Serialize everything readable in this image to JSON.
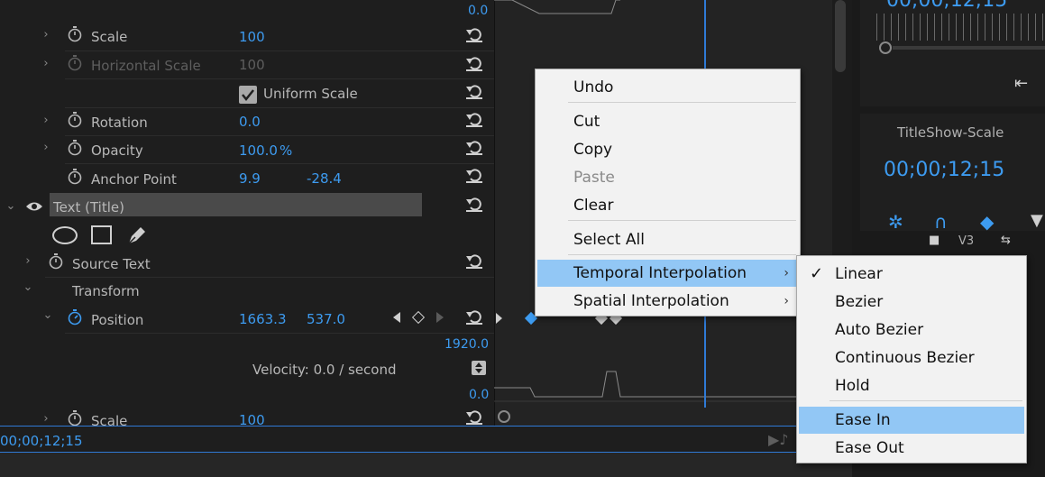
{
  "effect_controls": {
    "top_value": "0.0",
    "rows": [
      {
        "id": "scale",
        "name": "Scale",
        "value": "100"
      },
      {
        "id": "hscale",
        "name": "Horizontal Scale",
        "value": "100"
      },
      {
        "id": "uniform",
        "name": "Uniform Scale"
      },
      {
        "id": "rotation",
        "name": "Rotation",
        "value": "0.0"
      },
      {
        "id": "opacity",
        "name": "Opacity",
        "value": "100.0",
        "unit": "%"
      },
      {
        "id": "anchor",
        "name": "Anchor Point",
        "value_x": "9.9",
        "value_y": "-28.4"
      }
    ],
    "text_section": "Text (Title)",
    "source_text": "Source Text",
    "transform": "Transform",
    "position": {
      "name": "Position",
      "value_x": "1663.3",
      "value_y": "537.0"
    },
    "graph_max": "1920.0",
    "velocity": "Velocity: 0.0 / second",
    "graph_min": "0.0",
    "scale2": {
      "name": "Scale",
      "value": "100"
    },
    "current_time": "00;00;12;15"
  },
  "right_panel": {
    "sequence_name": "TitleShow-Scale",
    "sequence_time": "00;00;12;15",
    "top_time": "00;00;12;15",
    "track": "V3"
  },
  "context_menu": {
    "items": [
      {
        "label": "Undo"
      },
      {
        "label": "Cut"
      },
      {
        "label": "Copy"
      },
      {
        "label": "Paste",
        "disabled": true
      },
      {
        "label": "Clear"
      },
      {
        "label": "Select All"
      },
      {
        "label": "Temporal Interpolation",
        "submenu": true,
        "highlighted": true
      },
      {
        "label": "Spatial Interpolation",
        "submenu": true
      }
    ]
  },
  "submenu": {
    "items": [
      {
        "label": "Linear",
        "checked": true
      },
      {
        "label": "Bezier"
      },
      {
        "label": "Auto Bezier"
      },
      {
        "label": "Continuous Bezier"
      },
      {
        "label": "Hold"
      },
      {
        "label": "Ease In",
        "highlighted": true
      },
      {
        "label": "Ease Out"
      }
    ]
  },
  "colors": {
    "accent": "#3d9bf0",
    "highlight": "#92c7f5",
    "menu_bg": "#f2f2f2"
  }
}
